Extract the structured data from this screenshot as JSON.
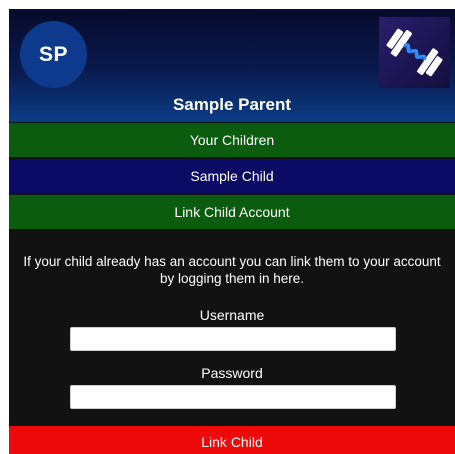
{
  "header": {
    "avatar_initials": "SP",
    "parent_name": "Sample Parent",
    "logo_icon": "dumbbell-icon",
    "colors": {
      "header_top": "#070a2c",
      "header_bottom": "#0b3d86",
      "avatar_bg": "#0d3a8d",
      "logo_bg": "#1b1450"
    }
  },
  "nav": {
    "items": [
      {
        "label": "Your Children",
        "color": "#0b5c0f"
      },
      {
        "label": "Sample Child",
        "color": "#0b0b66"
      },
      {
        "label": "Link Child Account",
        "color": "#0b5c0f"
      }
    ]
  },
  "link_form": {
    "info_text": "If your child already has an account you can link them to your account by logging them in here.",
    "username_label": "Username",
    "username_value": "",
    "password_label": "Password",
    "password_value": "",
    "submit_label": "Link Child",
    "submit_color": "#ee0a0a",
    "panel_color": "#121212"
  }
}
